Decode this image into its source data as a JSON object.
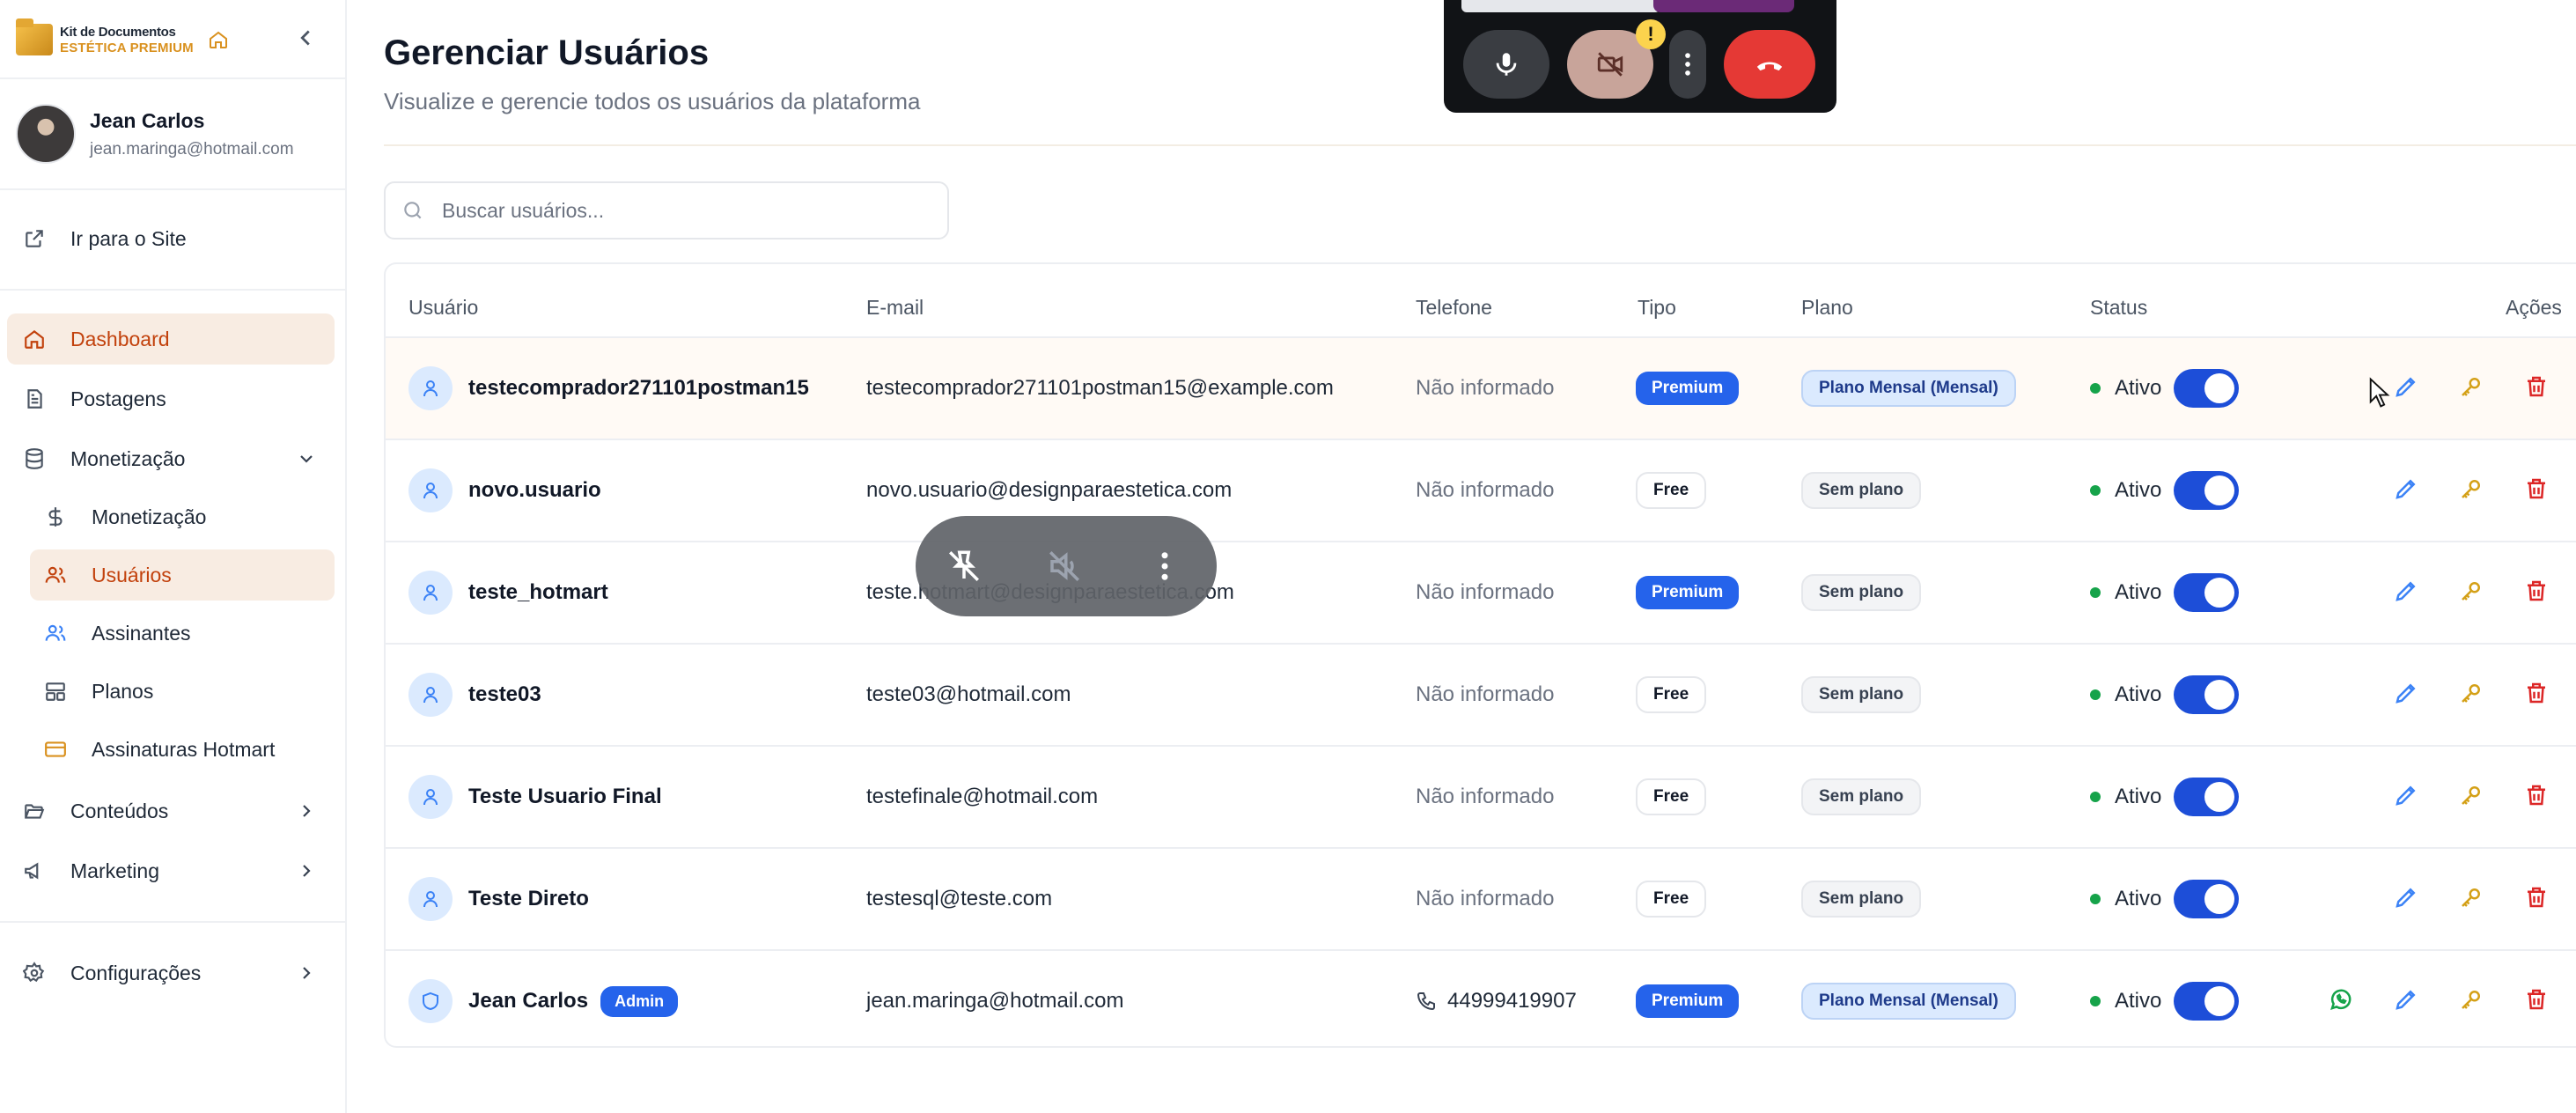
{
  "brand": {
    "line1": "Kit de Documentos",
    "line2": "ESTÉTICA PREMIUM"
  },
  "user": {
    "name": "Jean Carlos",
    "email": "jean.maringa@hotmail.com"
  },
  "nav": {
    "site": "Ir para o Site",
    "dashboard": "Dashboard",
    "postagens": "Postagens",
    "monetizacao_group": "Monetização",
    "monetizacao": "Monetização",
    "usuarios": "Usuários",
    "assinantes": "Assinantes",
    "planos": "Planos",
    "hotmart": "Assinaturas Hotmart",
    "conteudos": "Conteúdos",
    "marketing": "Marketing",
    "configuracoes": "Configurações"
  },
  "page": {
    "title": "Gerenciar Usuários",
    "subtitle": "Visualize e gerencie todos os usuários da plataforma"
  },
  "search": {
    "placeholder": "Buscar usuários..."
  },
  "table": {
    "headers": {
      "usuario": "Usuário",
      "email": "E-mail",
      "telefone": "Telefone",
      "tipo": "Tipo",
      "plano": "Plano",
      "status": "Status",
      "acoes": "Ações"
    },
    "rows": [
      {
        "name": "testecomprador271101postman15",
        "email": "testecomprador271101postman15@example.com",
        "phone": "Não informado",
        "type": "Premium",
        "plan": "Plano Mensal (Mensal)",
        "status": "Ativo"
      },
      {
        "name": "novo.usuario",
        "email": "novo.usuario@designparaestetica.com",
        "phone": "Não informado",
        "type": "Free",
        "plan": "Sem plano",
        "status": "Ativo"
      },
      {
        "name": "teste_hotmart",
        "email": "teste.hotmart@designparaestetica.com",
        "phone": "Não informado",
        "type": "Premium",
        "plan": "Sem plano",
        "status": "Ativo"
      },
      {
        "name": "teste03",
        "email": "teste03@hotmail.com",
        "phone": "Não informado",
        "type": "Free",
        "plan": "Sem plano",
        "status": "Ativo"
      },
      {
        "name": "Teste Usuario Final",
        "email": "testefinale@hotmail.com",
        "phone": "Não informado",
        "type": "Free",
        "plan": "Sem plano",
        "status": "Ativo"
      },
      {
        "name": "Teste Direto",
        "email": "testesql@teste.com",
        "phone": "Não informado",
        "type": "Free",
        "plan": "Sem plano",
        "status": "Ativo"
      },
      {
        "name": "Jean Carlos",
        "badge": "Admin",
        "email": "jean.maringa@hotmail.com",
        "phone": "44999419907",
        "type": "Premium",
        "plan": "Plano Mensal (Mensal)",
        "status": "Ativo"
      }
    ]
  },
  "call": {
    "warning": "!"
  }
}
